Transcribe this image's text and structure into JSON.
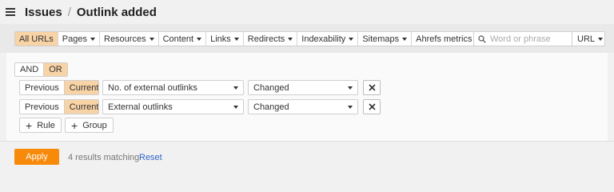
{
  "header": {
    "breadcrumb_root": "Issues",
    "separator": "/",
    "page_title": "Outlink added"
  },
  "toolbar": {
    "filters": [
      {
        "label": "All URLs",
        "active": true,
        "dropdown": false
      },
      {
        "label": "Pages",
        "active": false,
        "dropdown": true
      },
      {
        "label": "Resources",
        "active": false,
        "dropdown": true
      },
      {
        "label": "Content",
        "active": false,
        "dropdown": true
      },
      {
        "label": "Links",
        "active": false,
        "dropdown": true
      },
      {
        "label": "Redirects",
        "active": false,
        "dropdown": true
      },
      {
        "label": "Indexability",
        "active": false,
        "dropdown": true
      },
      {
        "label": "Sitemaps",
        "active": false,
        "dropdown": true
      },
      {
        "label": "Ahrefs metrics",
        "active": false,
        "dropdown": true
      }
    ],
    "search_placeholder": "Word or phrase",
    "search_value": "",
    "scope_select": "URL"
  },
  "rules": {
    "logic": {
      "and_label": "AND",
      "or_label": "OR",
      "selected": "OR"
    },
    "rows": [
      {
        "previous_label": "Previous",
        "current_label": "Current",
        "selected": "Current",
        "field": "No. of external outlinks",
        "condition": "Changed"
      },
      {
        "previous_label": "Previous",
        "current_label": "Current",
        "selected": "Current",
        "field": "External outlinks",
        "condition": "Changed"
      }
    ],
    "add_rule_label": "Rule",
    "add_group_label": "Group"
  },
  "footer": {
    "apply_label": "Apply",
    "results_text": "4 results matching",
    "reset_label": "Reset"
  },
  "colors": {
    "accent": "#f88a0b",
    "active_segment": "#f7d3a6",
    "link": "#3366cc"
  },
  "icons": {
    "menu": "hamburger-icon",
    "search": "search-icon",
    "remove": "close-icon",
    "add": "plus-icon",
    "dropdown": "chevron-down-icon"
  }
}
